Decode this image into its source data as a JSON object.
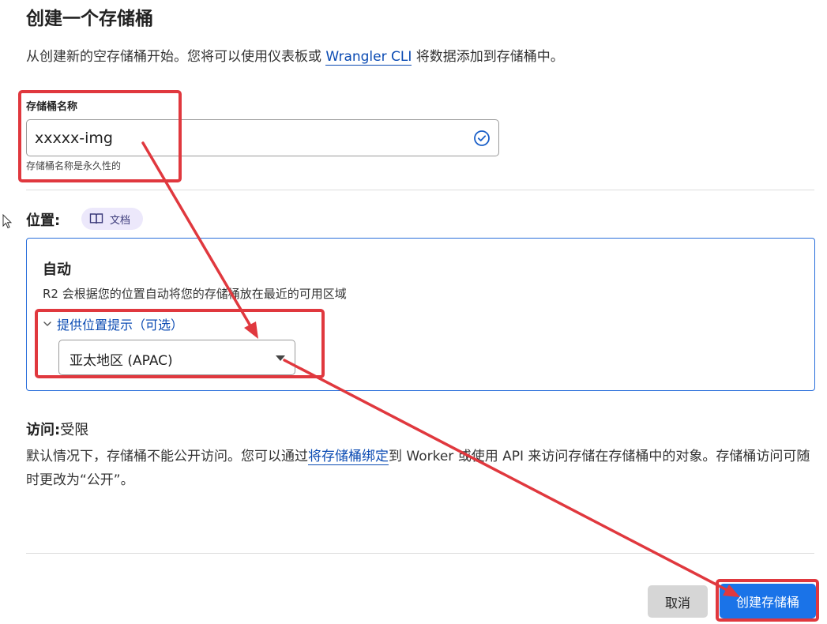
{
  "page": {
    "title": "创建一个存储桶",
    "intro_before": "从创建新的空存储桶开始。您将可以使用仪表板或 ",
    "intro_link": "Wrangler CLI",
    "intro_after": " 将数据添加到存储桶中。"
  },
  "bucket_name": {
    "label": "存储桶名称",
    "value": "xxxxx-img",
    "helper": "存储桶名称是永久性的",
    "status_icon": "check-circle-icon"
  },
  "location": {
    "label": "位置:",
    "docs_label": "文档",
    "docs_icon": "book-icon",
    "card_title": "自动",
    "card_desc": "R2 会根据您的位置自动将您的存储桶放在最近的可用区域",
    "hint_toggle": "提供位置提示（可选）",
    "region_selected": "亚太地区 (APAC)"
  },
  "access": {
    "label": "访问:",
    "value": "受限",
    "desc_before": "默认情况下，存储桶不能公开访问。您可以通过",
    "desc_link": "将存储桶绑定",
    "desc_after": "到 Worker 或使用 API 来访问存储在存储桶中的对象。存储桶访问可随时更改为“公开”。"
  },
  "actions": {
    "cancel": "取消",
    "create": "创建存储桶"
  },
  "colors": {
    "accent": "#1a73e8",
    "link": "#0b4bb3",
    "annotation": "#e0383e"
  }
}
